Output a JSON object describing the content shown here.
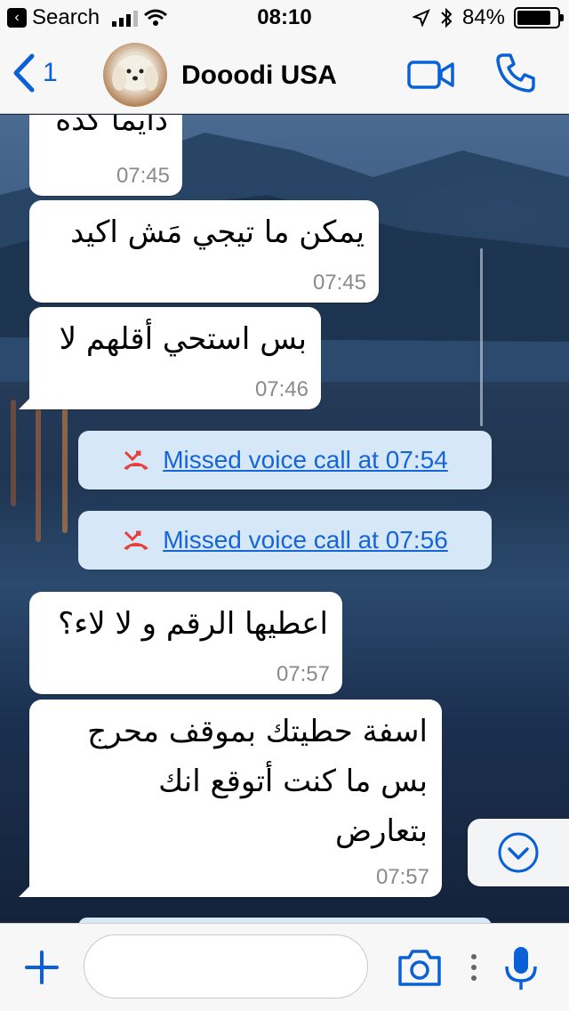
{
  "status_bar": {
    "back_app": "Search",
    "time": "08:10",
    "battery": "84%",
    "battery_level": 0.84
  },
  "nav": {
    "back_count": "1",
    "contact_name": "Dooodi USA"
  },
  "messages": [
    {
      "text": "دايما كده",
      "time": "07:45"
    },
    {
      "text": "يمكن ما تيجي مَش اكيد",
      "time": "07:45"
    },
    {
      "text": "بس استحي أقلهم لا",
      "time": "07:46"
    },
    {
      "text": "اعطيها الرقم و لا لاء؟",
      "time": "07:57"
    },
    {
      "text": "اسفة حطيتك بموقف محرج\nبس ما كنت أتوقع انك\nبتعارض",
      "time": "07:57"
    }
  ],
  "system_messages": [
    {
      "label": "Missed voice call at 07:54"
    },
    {
      "label": "Missed voice call at 07:56"
    }
  ],
  "input": {
    "placeholder": ""
  }
}
